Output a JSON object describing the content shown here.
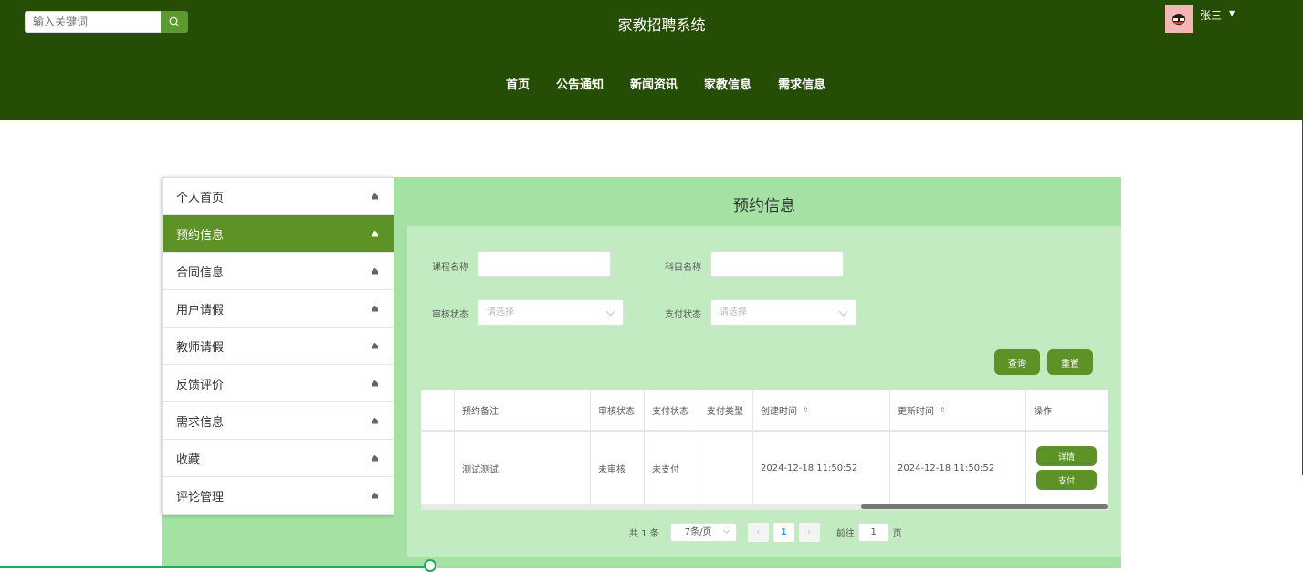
{
  "header": {
    "search_placeholder": "输入关键词",
    "title": "家教招聘系统",
    "user_name": "张三",
    "nav": [
      "首页",
      "公告通知",
      "新闻资讯",
      "家教信息",
      "需求信息"
    ]
  },
  "sidebar": {
    "items": [
      {
        "label": "个人首页",
        "active": false
      },
      {
        "label": "预约信息",
        "active": true
      },
      {
        "label": "合同信息",
        "active": false
      },
      {
        "label": "用户请假",
        "active": false
      },
      {
        "label": "教师请假",
        "active": false
      },
      {
        "label": "反馈评价",
        "active": false
      },
      {
        "label": "需求信息",
        "active": false
      },
      {
        "label": "收藏",
        "active": false
      },
      {
        "label": "评论管理",
        "active": false
      }
    ]
  },
  "main": {
    "title": "预约信息",
    "filters": {
      "course_name_label": "课程名称",
      "course_name_value": "",
      "subject_name_label": "科目名称",
      "subject_name_value": "",
      "audit_status_label": "审核状态",
      "audit_status_placeholder": "请选择",
      "pay_status_label": "支付状态",
      "pay_status_placeholder": "请选择"
    },
    "buttons": {
      "query": "查询",
      "reset": "重置"
    },
    "table": {
      "headers": [
        "",
        "预约备注",
        "审核状态",
        "支付状态",
        "支付类型",
        "创建时间",
        "更新时间",
        "操作"
      ],
      "rows": [
        {
          "check": "",
          "remark": "测试测试",
          "audit_status": "未审核",
          "pay_status": "未支付",
          "pay_type": "",
          "created": "2024-12-18 11:50:52",
          "updated": "2024-12-18 11:50:52",
          "detail_btn": "详情",
          "pay_btn": "支付"
        }
      ]
    },
    "pagination": {
      "total": "共 1 条",
      "page_size": "7条/页",
      "current_page": "1",
      "goto_label": "前往",
      "goto_value": "1",
      "page_suffix": "页"
    }
  },
  "page_progress": 0.33,
  "colors": {
    "header_bg": "#264d06",
    "accent": "#5d9226",
    "panel_bg": "#a3e2a3",
    "panel_inner": "#c2ebc2"
  }
}
